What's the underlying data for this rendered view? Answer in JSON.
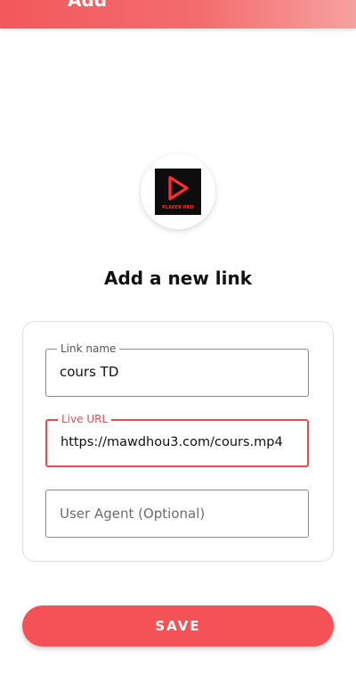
{
  "appbar": {
    "title": "Add"
  },
  "logo": {
    "text": "PLAYER PRO"
  },
  "heading": "Add a new link",
  "form": {
    "link_name": {
      "label": "Link name",
      "value": "cours TD"
    },
    "live_url": {
      "label": "Live URL",
      "value": "https://mawdhou3.com/cours.mp4"
    },
    "user_agent": {
      "placeholder": "User Agent (Optional)",
      "value": ""
    }
  },
  "save_button": {
    "label": "SAVE"
  },
  "colors": {
    "accent": "#f45257",
    "focus_border": "#e84a4f",
    "text": "#111111"
  }
}
